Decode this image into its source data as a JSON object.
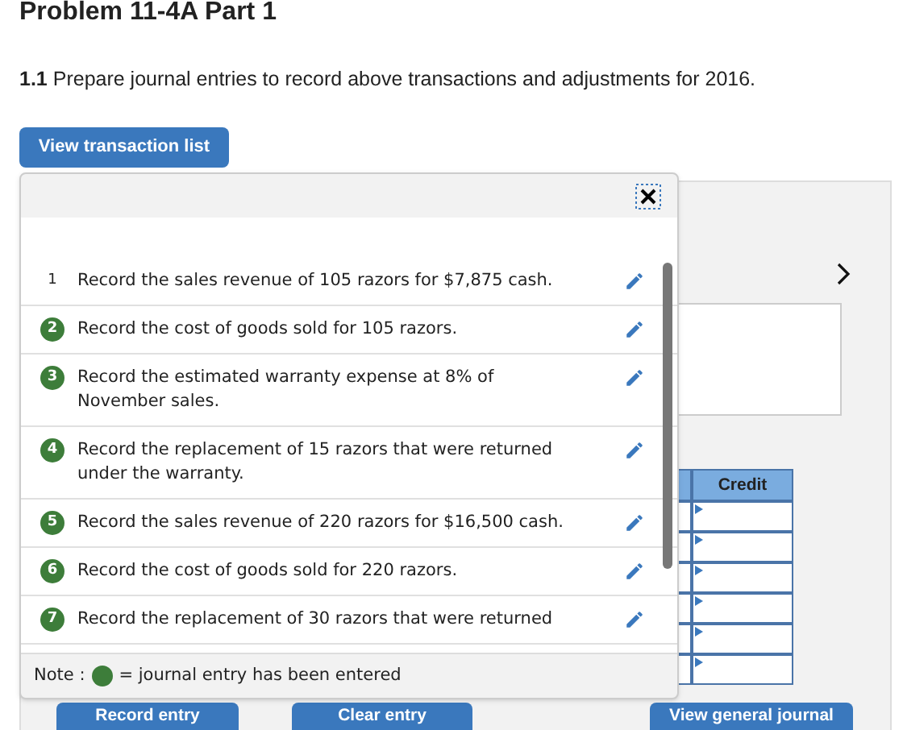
{
  "title": "Problem 11-4A Part 1",
  "instruction": "**1.1** Prepare journal entries to record above transactions and adjustments for 2016.",
  "view_list_button": "View transaction list",
  "transactions": [
    {
      "number": "1",
      "text": "Record the sales revenue of 105 razors for $7,875 cash.",
      "entered": false
    },
    {
      "number": "2",
      "text": "Record the cost of goods sold for 105 razors.",
      "entered": true
    },
    {
      "number": "3",
      "text": "Record the estimated warranty expense at 8% of November sales.",
      "entered": true
    },
    {
      "number": "4",
      "text": "Record the replacement of 15 razors that were returned under the warranty.",
      "entered": true
    },
    {
      "number": "5",
      "text": "Record the sales revenue of 220 razors for $16,500 cash.",
      "entered": true
    },
    {
      "number": "6",
      "text": "Record the cost of goods sold for 220 razors.",
      "entered": true
    },
    {
      "number": "7",
      "text": "Record the replacement of 30 razors that were returned",
      "entered": true
    }
  ],
  "note": {
    "label": "Note :",
    "text": "= journal entry has been entered"
  },
  "journal": {
    "credit_header": "Credit"
  },
  "buttons": [
    "Record entry",
    "Clear entry",
    "View general journal"
  ]
}
